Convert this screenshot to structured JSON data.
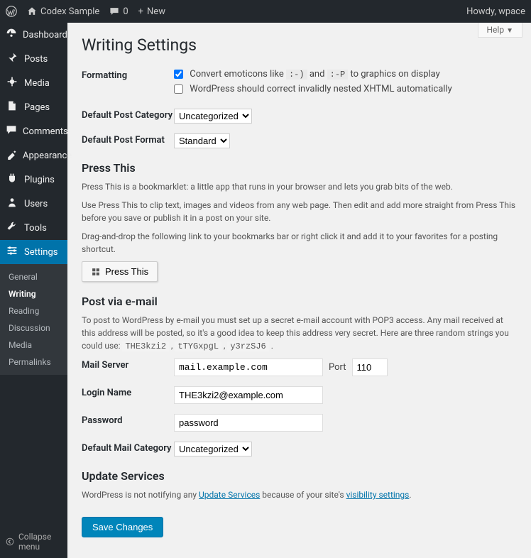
{
  "adminbar": {
    "site_name": "Codex Sample",
    "comments_count": "0",
    "new_label": "New",
    "howdy": "Howdy, wpace",
    "help_label": "Help"
  },
  "sidebar": {
    "items": [
      {
        "icon": "dashboard",
        "label": "Dashboard"
      },
      {
        "icon": "pin",
        "label": "Posts"
      },
      {
        "icon": "media",
        "label": "Media"
      },
      {
        "icon": "page",
        "label": "Pages"
      },
      {
        "icon": "comment",
        "label": "Comments"
      },
      {
        "icon": "appearance",
        "label": "Appearance"
      },
      {
        "icon": "plugin",
        "label": "Plugins"
      },
      {
        "icon": "users",
        "label": "Users"
      },
      {
        "icon": "tools",
        "label": "Tools"
      },
      {
        "icon": "settings",
        "label": "Settings"
      }
    ],
    "submenu": [
      {
        "label": "General"
      },
      {
        "label": "Writing"
      },
      {
        "label": "Reading"
      },
      {
        "label": "Discussion"
      },
      {
        "label": "Media"
      },
      {
        "label": "Permalinks"
      }
    ],
    "collapse_label": "Collapse menu"
  },
  "page": {
    "title": "Writing Settings",
    "formatting_label": "Formatting",
    "emoticons_prefix": "Convert emoticons like",
    "emoticons_code1": ":-)",
    "emoticons_and": "and",
    "emoticons_code2": ":-P",
    "emoticons_suffix": "to graphics on display",
    "emoticons_checked": true,
    "xhtml_label": "WordPress should correct invalidly nested XHTML automatically",
    "xhtml_checked": false,
    "default_category_label": "Default Post Category",
    "default_category_value": "Uncategorized",
    "default_format_label": "Default Post Format",
    "default_format_value": "Standard",
    "press_this_heading": "Press This",
    "press_this_desc1": "Press This is a bookmarklet: a little app that runs in your browser and lets you grab bits of the web.",
    "press_this_desc2": "Use Press This to clip text, images and videos from any web page. Then edit and add more straight from Press This before you save or publish it in a post on your site.",
    "press_this_desc3": "Drag-and-drop the following link to your bookmarks bar or right click it and add it to your favorites for a posting shortcut.",
    "press_this_button": "Press This",
    "post_via_email_heading": "Post via e-mail",
    "post_via_email_desc_prefix": "To post to WordPress by e-mail you must set up a secret e-mail account with POP3 access. Any mail received at this address will be posted, so it's a good idea to keep this address very secret. Here are three random strings you could use:",
    "random_strings": [
      "THE3kzi2",
      "tTYGxpgL",
      "y3rzSJ6"
    ],
    "mail_server_label": "Mail Server",
    "mail_server_value": "mail.example.com",
    "port_label": "Port",
    "port_value": "110",
    "login_name_label": "Login Name",
    "login_name_value": "THE3kzi2@example.com",
    "password_label": "Password",
    "password_value": "password",
    "default_mail_category_label": "Default Mail Category",
    "default_mail_category_value": "Uncategorized",
    "update_services_heading": "Update Services",
    "update_services_prefix": "WordPress is not notifying any",
    "update_services_link1": "Update Services",
    "update_services_mid": "because of your site's",
    "update_services_link2": "visibility settings",
    "save_button": "Save Changes"
  }
}
